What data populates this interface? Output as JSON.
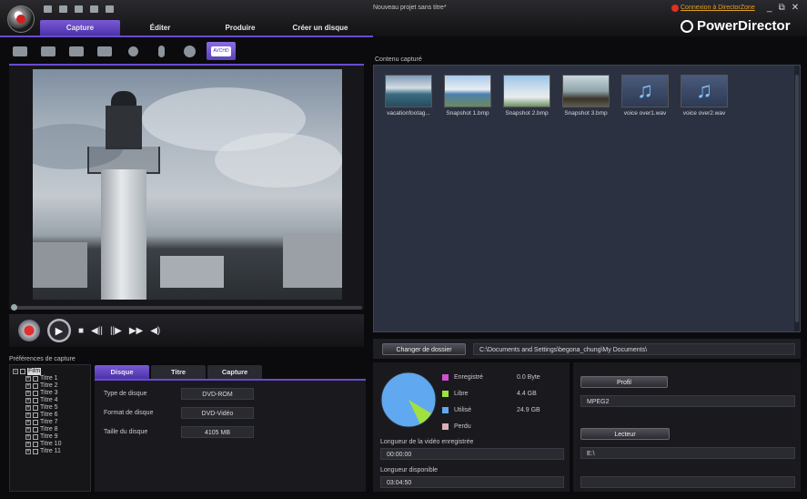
{
  "app": {
    "window_title": "Nouveau projet sans titre*",
    "brand": "PowerDirector",
    "connect_link": "Connexion à DirectorZone"
  },
  "window_controls": {
    "minimize": "_",
    "restore": "⧉",
    "close": "✕"
  },
  "tabs": [
    {
      "label": "Capture",
      "active": true
    },
    {
      "label": "Éditer",
      "active": false
    },
    {
      "label": "Produire",
      "active": false
    },
    {
      "label": "Créer un disque",
      "active": false
    }
  ],
  "capture_tools": [
    {
      "icon": "dv-camcorder-icon",
      "active": false
    },
    {
      "icon": "hdv-camcorder-icon",
      "active": false
    },
    {
      "icon": "tv-icon",
      "active": false
    },
    {
      "icon": "digital-tv-icon",
      "active": false
    },
    {
      "icon": "webcam-icon",
      "active": false
    },
    {
      "icon": "microphone-icon",
      "active": false
    },
    {
      "icon": "cd-icon",
      "active": false
    },
    {
      "icon": "avchd-icon",
      "active": true,
      "label": "AVCHD"
    }
  ],
  "player": {
    "record_icon": "record-icon",
    "play": "▶",
    "stop": "■",
    "prev_frame": "◀||",
    "next_frame": "||▶",
    "fast_forward": "▶▶",
    "volume": "◀)"
  },
  "preferences": {
    "label": "Préférences de capture",
    "tree_root": "Film",
    "titles": [
      "Titre 1",
      "Titre 2",
      "Titre 3",
      "Titre 4",
      "Titre 5",
      "Titre 6",
      "Titre 7",
      "Titre 8",
      "Titre 9",
      "Titre 10",
      "Titre 11"
    ],
    "tabs": [
      {
        "label": "Disque",
        "active": true
      },
      {
        "label": "Titre",
        "active": false
      },
      {
        "label": "Capture",
        "active": false
      }
    ],
    "rows": [
      {
        "label": "Type de disque",
        "value": "DVD-ROM"
      },
      {
        "label": "Format de disque",
        "value": "DVD-Vidéo"
      },
      {
        "label": "Taille du disque",
        "value": "4105 MB"
      }
    ]
  },
  "content": {
    "label": "Contenu capturé",
    "items": [
      {
        "name": "vacationfootag...",
        "kind": "video"
      },
      {
        "name": "Snapshot 1.bmp",
        "kind": "image"
      },
      {
        "name": "Snapshot 2.bmp",
        "kind": "image"
      },
      {
        "name": "Snapshot 3.bmp",
        "kind": "image"
      },
      {
        "name": "voice over1.wav",
        "kind": "audio"
      },
      {
        "name": "voice over2.wav",
        "kind": "audio"
      }
    ]
  },
  "folder": {
    "button": "Changer de dossier",
    "path": "C:\\Documents and Settings\\begona_chung\\My Documents\\"
  },
  "disk_info": {
    "legend": [
      {
        "label": "Enregistré",
        "value": "0.0 Byte",
        "color": "#d050d0"
      },
      {
        "label": "Libre",
        "value": "4.4 GB",
        "color": "#a0e040"
      },
      {
        "label": "Utilisé",
        "value": "24.9 GB",
        "color": "#60a8f0"
      },
      {
        "label": "Perdu",
        "value": "",
        "color": "#d8b0b8"
      }
    ],
    "recorded_length_label": "Longueur de la vidéo enregistrée",
    "recorded_length": "00:00:00",
    "available_length_label": "Longueur disponible",
    "available_length": "03:04:50"
  },
  "profile": {
    "button": "Profil",
    "value": "MPEG2",
    "reader_button": "Lecteur",
    "reader_value": "E:\\"
  },
  "colors": {
    "accent": "#6a4ad0",
    "panel": "#2b3140"
  }
}
